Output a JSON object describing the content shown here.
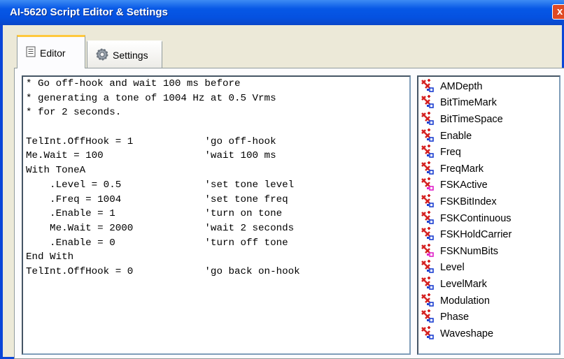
{
  "window": {
    "title": "AI-5620 Script Editor & Settings",
    "close_label": "x"
  },
  "tabs": [
    {
      "label": "Editor",
      "icon": "document-icon",
      "active": true
    },
    {
      "label": "Settings",
      "icon": "gear-icon",
      "active": false
    }
  ],
  "editor": {
    "lines": [
      "* Go off-hook and wait 100 ms before",
      "* generating a tone of 1004 Hz at 0.5 Vrms",
      "* for 2 seconds.",
      "",
      "TelInt.OffHook = 1            'go off-hook",
      "Me.Wait = 100                 'wait 100 ms",
      "With ToneA",
      "    .Level = 0.5              'set tone level",
      "    .Freq = 1004              'set tone freq",
      "    .Enable = 1               'turn on tone",
      "    Me.Wait = 2000            'wait 2 seconds",
      "    .Enable = 0               'turn off tone",
      "End With",
      "TelInt.OffHook = 0            'go back on-hook"
    ]
  },
  "properties": {
    "icon_colors": {
      "red": "#d42020",
      "blue": "#1c3fd0",
      "magenta": "#e020c8"
    },
    "items": [
      {
        "label": "AMDepth",
        "icon": "property-icon"
      },
      {
        "label": "BitTimeMark",
        "icon": "property-icon"
      },
      {
        "label": "BitTimeSpace",
        "icon": "property-icon"
      },
      {
        "label": "Enable",
        "icon": "property-icon"
      },
      {
        "label": "Freq",
        "icon": "property-icon"
      },
      {
        "label": "FreqMark",
        "icon": "property-icon"
      },
      {
        "label": "FSKActive",
        "icon": "readonly-property-icon"
      },
      {
        "label": "FSKBitIndex",
        "icon": "property-icon"
      },
      {
        "label": "FSKContinuous",
        "icon": "property-icon"
      },
      {
        "label": "FSKHoldCarrier",
        "icon": "property-icon"
      },
      {
        "label": "FSKNumBits",
        "icon": "readonly-property-icon"
      },
      {
        "label": "Level",
        "icon": "property-icon"
      },
      {
        "label": "LevelMark",
        "icon": "property-icon"
      },
      {
        "label": "Modulation",
        "icon": "property-icon"
      },
      {
        "label": "Phase",
        "icon": "property-icon"
      },
      {
        "label": "Waveshape",
        "icon": "property-icon"
      }
    ]
  }
}
